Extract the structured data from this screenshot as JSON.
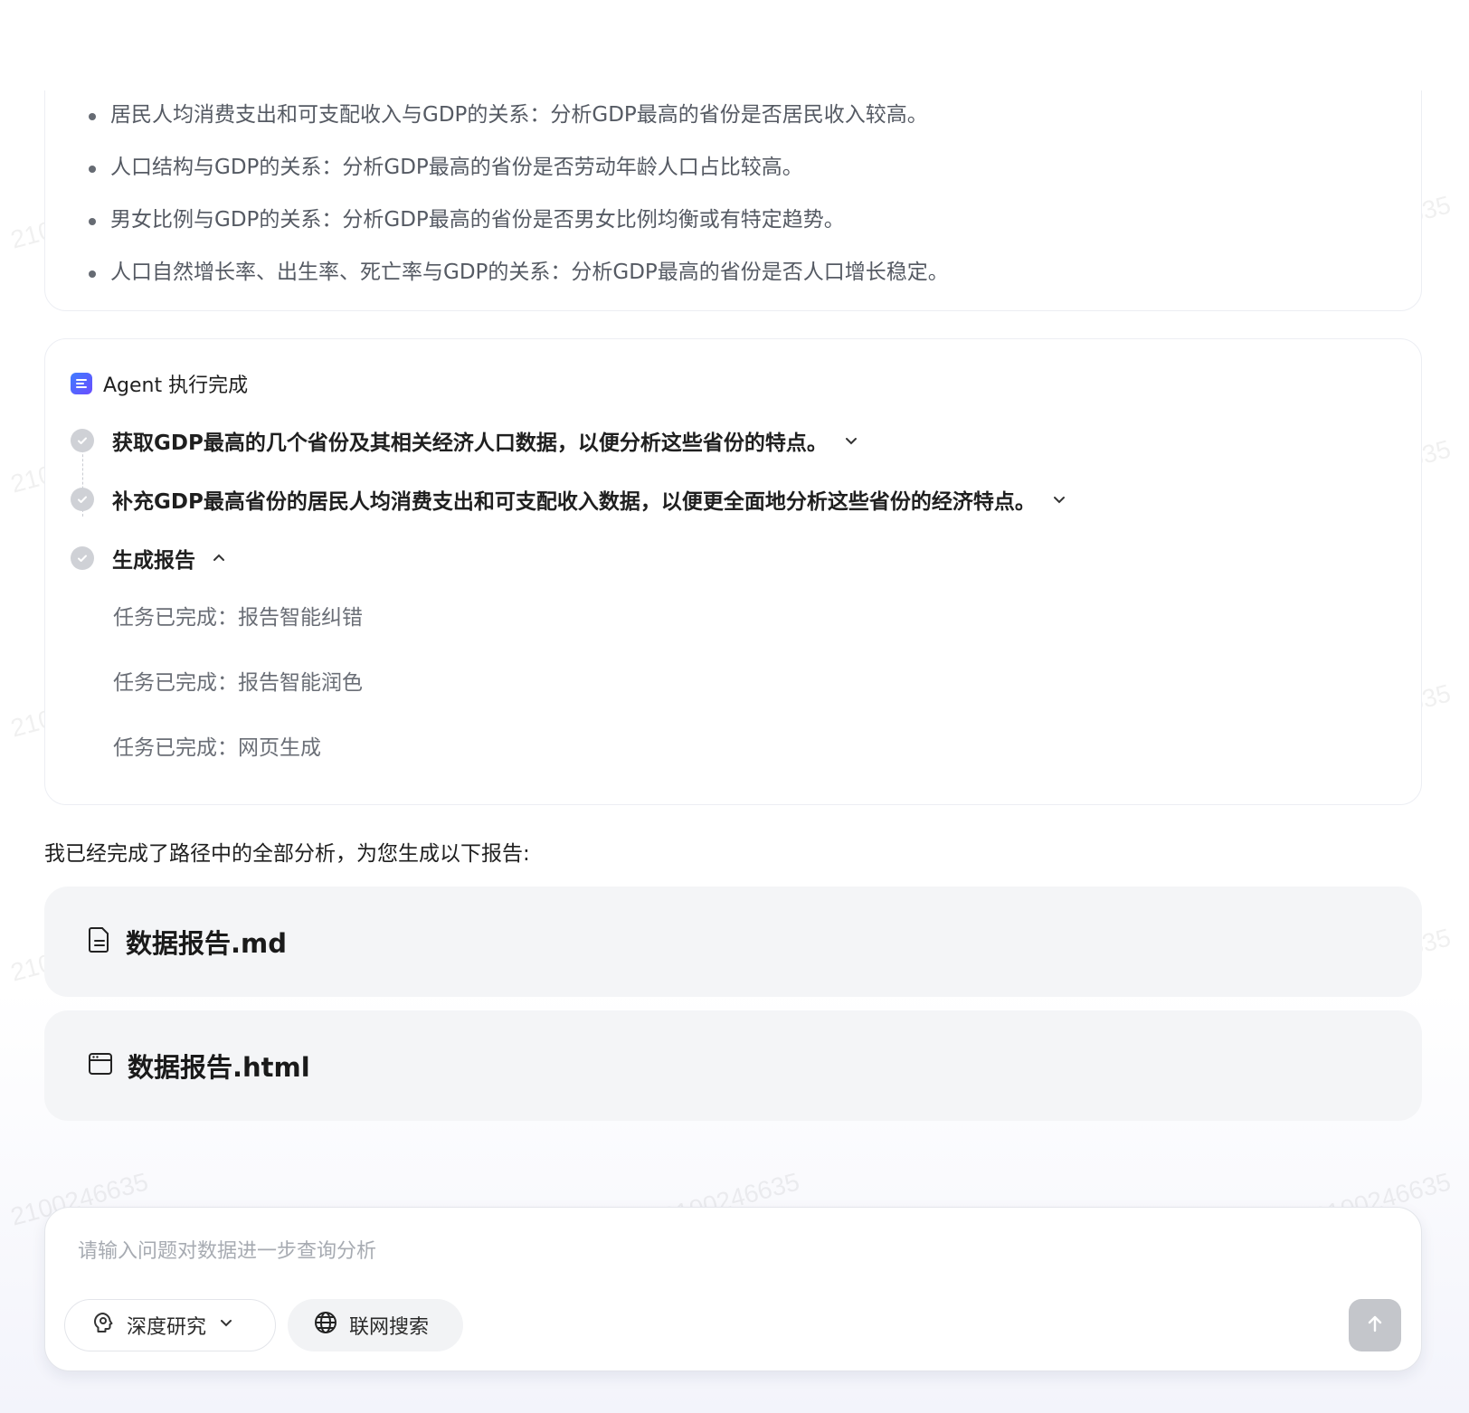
{
  "watermark": "2100246635",
  "top_card": {
    "bullets": [
      "居民人均消费支出和可支配收入与GDP的关系：分析GDP最高的省份是否居民收入较高。",
      "人口结构与GDP的关系：分析GDP最高的省份是否劳动年龄人口占比较高。",
      "男女比例与GDP的关系：分析GDP最高的省份是否男女比例均衡或有特定趋势。",
      "人口自然增长率、出生率、死亡率与GDP的关系：分析GDP最高的省份是否人口增长稳定。"
    ]
  },
  "agent": {
    "title": "Agent 执行完成",
    "steps": [
      {
        "label": "获取GDP最高的几个省份及其相关经济人口数据，以便分析这些省份的特点。",
        "expanded": false
      },
      {
        "label": "补充GDP最高省份的居民人均消费支出和可支配收入数据，以便更全面地分析这些省份的经济特点。",
        "expanded": false
      },
      {
        "label": "生成报告",
        "expanded": true
      }
    ],
    "subtasks": [
      "任务已完成：报告智能纠错",
      "任务已完成：报告智能润色",
      "任务已完成：网页生成"
    ]
  },
  "summary": "我已经完成了路径中的全部分析，为您生成以下报告:",
  "files": [
    {
      "name": "数据报告.md",
      "icon": "document-icon"
    },
    {
      "name": "数据报告.html",
      "icon": "browser-window-icon"
    }
  ],
  "input": {
    "placeholder": "请输入问题对数据进一步查询分析",
    "deep_research_label": "深度研究",
    "web_search_label": "联网搜索"
  },
  "colors": {
    "accent": "#3f7dff",
    "check_gray": "#cfd1d6",
    "file_bg": "#f4f5f7",
    "send_disabled": "#c4c6cb"
  }
}
